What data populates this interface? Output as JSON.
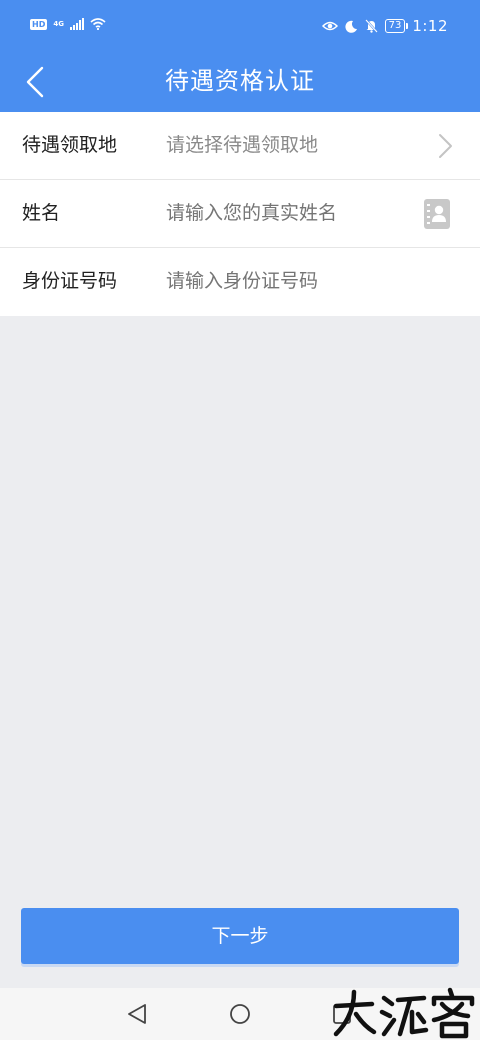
{
  "status": {
    "hd": "HD",
    "network": "4G",
    "battery": "73",
    "time": "1:12"
  },
  "nav": {
    "title": "待遇资格认证"
  },
  "form": {
    "rows": [
      {
        "label": "待遇领取地",
        "placeholder": "请选择待遇领取地"
      },
      {
        "label": "姓名",
        "placeholder": "请输入您的真实姓名"
      },
      {
        "label": "身份证号码",
        "placeholder": "请输入身份证号码"
      }
    ]
  },
  "actions": {
    "next": "下一步"
  },
  "colors": {
    "primary": "#4a8ef0",
    "page_bg": "#ecedf0"
  },
  "icons": [
    "back-arrow-icon",
    "chevron-right-icon",
    "contact-book-icon",
    "nav-back-icon",
    "nav-home-icon",
    "nav-recent-icon"
  ]
}
